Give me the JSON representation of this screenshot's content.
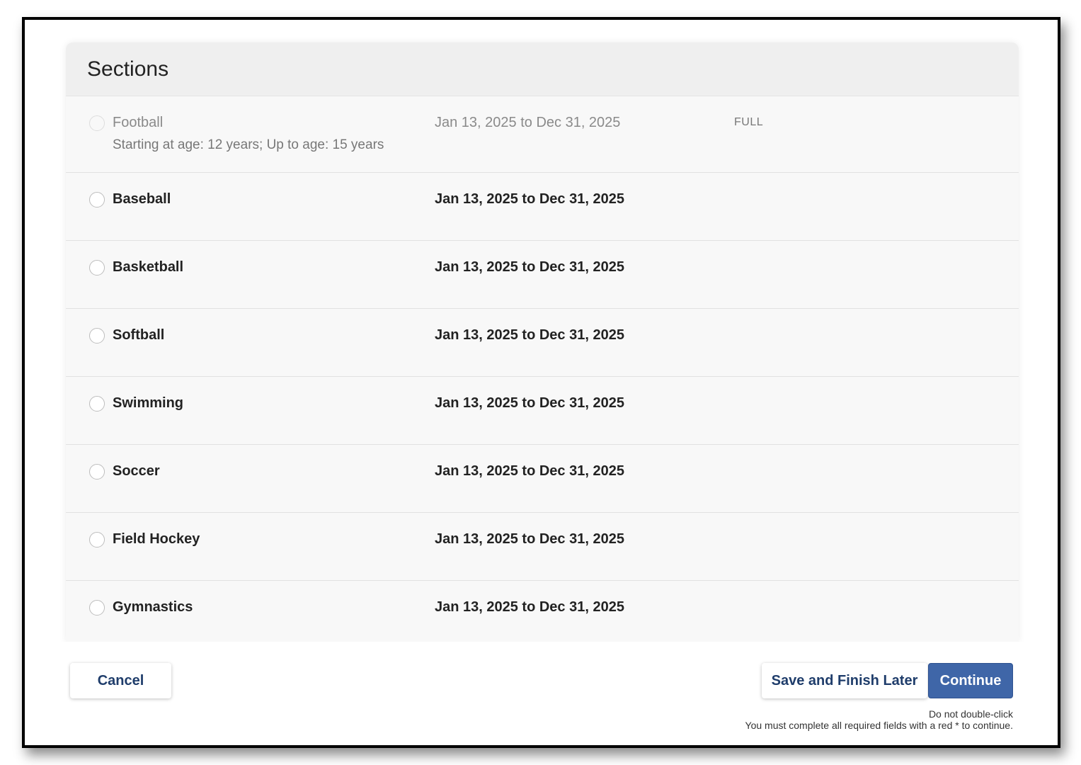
{
  "panel": {
    "title": "Sections"
  },
  "sections": [
    {
      "name": "Football",
      "subtext": "Starting at age: 12 years; Up to age: 15 years",
      "dates": "Jan 13, 2025 to Dec 31, 2025",
      "status": "FULL"
    },
    {
      "name": "Baseball",
      "dates": "Jan 13, 2025 to Dec 31, 2025"
    },
    {
      "name": "Basketball",
      "dates": "Jan 13, 2025 to Dec 31, 2025"
    },
    {
      "name": "Softball",
      "dates": "Jan 13, 2025 to Dec 31, 2025"
    },
    {
      "name": "Swimming",
      "dates": "Jan 13, 2025 to Dec 31, 2025"
    },
    {
      "name": "Soccer",
      "dates": "Jan 13, 2025 to Dec 31, 2025"
    },
    {
      "name": "Field Hockey",
      "dates": "Jan 13, 2025 to Dec 31, 2025"
    },
    {
      "name": "Gymnastics",
      "dates": "Jan 13, 2025 to Dec 31, 2025"
    }
  ],
  "footer": {
    "cancel_label": "Cancel",
    "save_label": "Save and Finish Later",
    "continue_label": "Continue",
    "note_double_click": "Do not double-click",
    "note_required": "You must complete all required fields with a red * to continue."
  },
  "colors": {
    "primary_button": "#3f66a8",
    "link_text": "#1f3d6b"
  }
}
